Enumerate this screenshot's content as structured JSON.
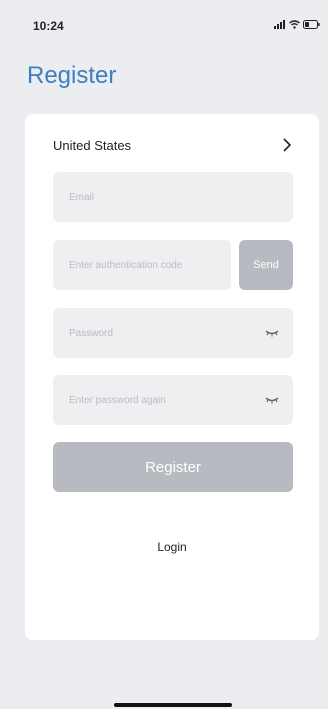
{
  "status_bar": {
    "time": "10:24"
  },
  "page": {
    "title": "Register"
  },
  "form": {
    "region_label": "United States",
    "email_placeholder": "Email",
    "code_placeholder": "Enter authentication code",
    "send_label": "Send",
    "password_placeholder": "Password",
    "password_again_placeholder": "Enter password again",
    "register_label": "Register",
    "login_label": "Login"
  },
  "colors": {
    "accent": "#3d7fc2",
    "button_disabled": "#b7bac0",
    "field_bg": "#eeeff1",
    "background": "#ecedf0"
  },
  "icons": {
    "region_row": "chevron-right-icon",
    "password_toggle": "eye-closed-icon",
    "status": [
      "signal-icon",
      "wifi-icon",
      "battery-icon"
    ]
  }
}
